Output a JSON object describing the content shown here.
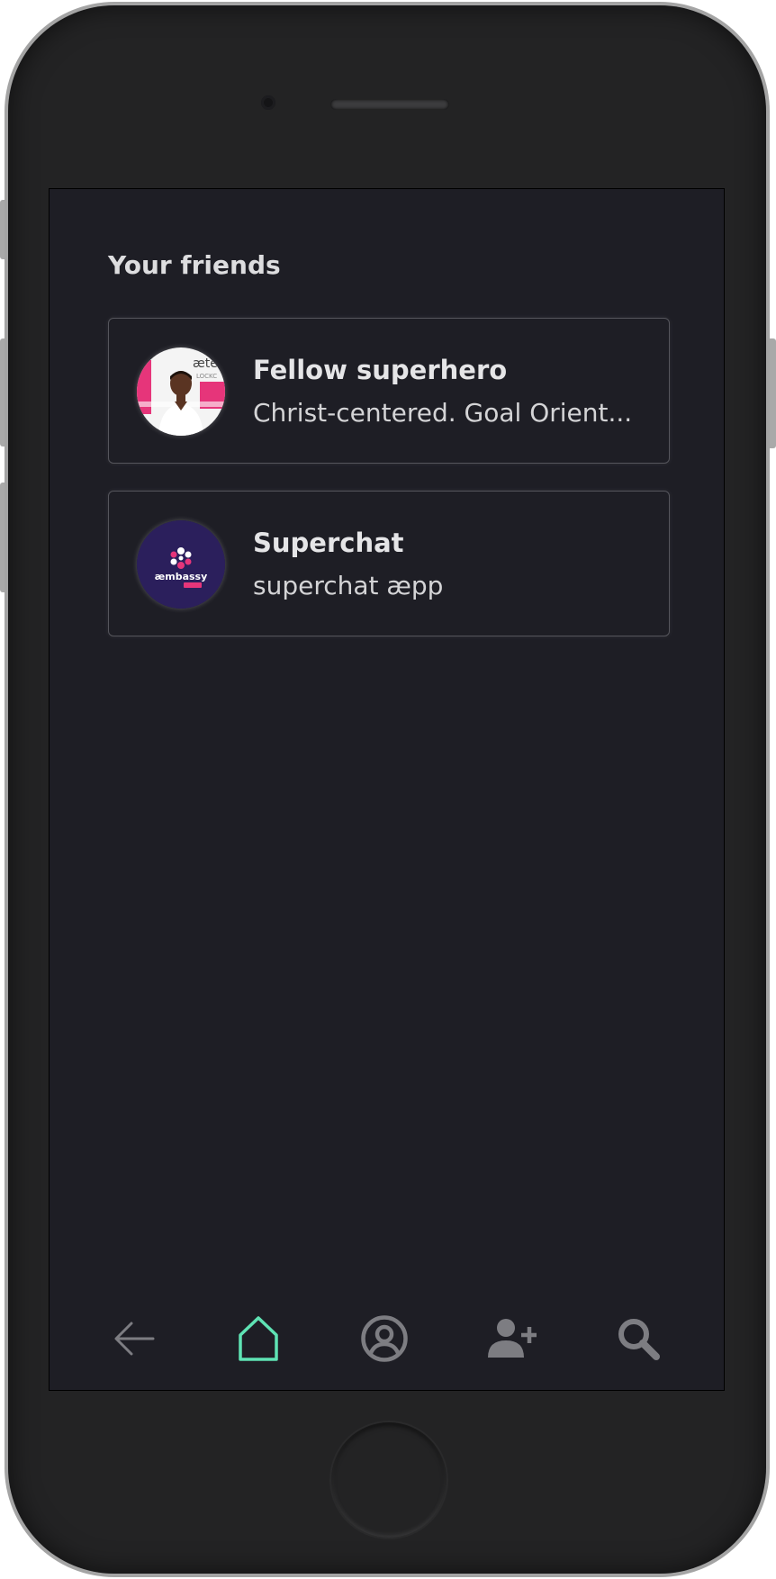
{
  "screen": {
    "section_title": "Your friends"
  },
  "friends": [
    {
      "name": "Fellow superhero",
      "status": "Christ-centered. Goal Orient...",
      "avatar_icon": "person-photo-avatar"
    },
    {
      "name": "Superchat",
      "status": "superchat æpp",
      "avatar_icon": "aembassy-logo-avatar",
      "avatar_text": "æmbassy"
    }
  ],
  "nav": {
    "items": [
      {
        "icon": "arrow-left-icon"
      },
      {
        "icon": "home-icon",
        "active": true
      },
      {
        "icon": "user-circle-icon"
      },
      {
        "icon": "user-plus-icon"
      },
      {
        "icon": "search-icon"
      }
    ],
    "active_color": "#5fe3b4",
    "inactive_color": "#7d7d82"
  },
  "colors": {
    "screen_bg": "#1e1e25",
    "card_border": "#55555c",
    "phone_frame": "#232324"
  }
}
